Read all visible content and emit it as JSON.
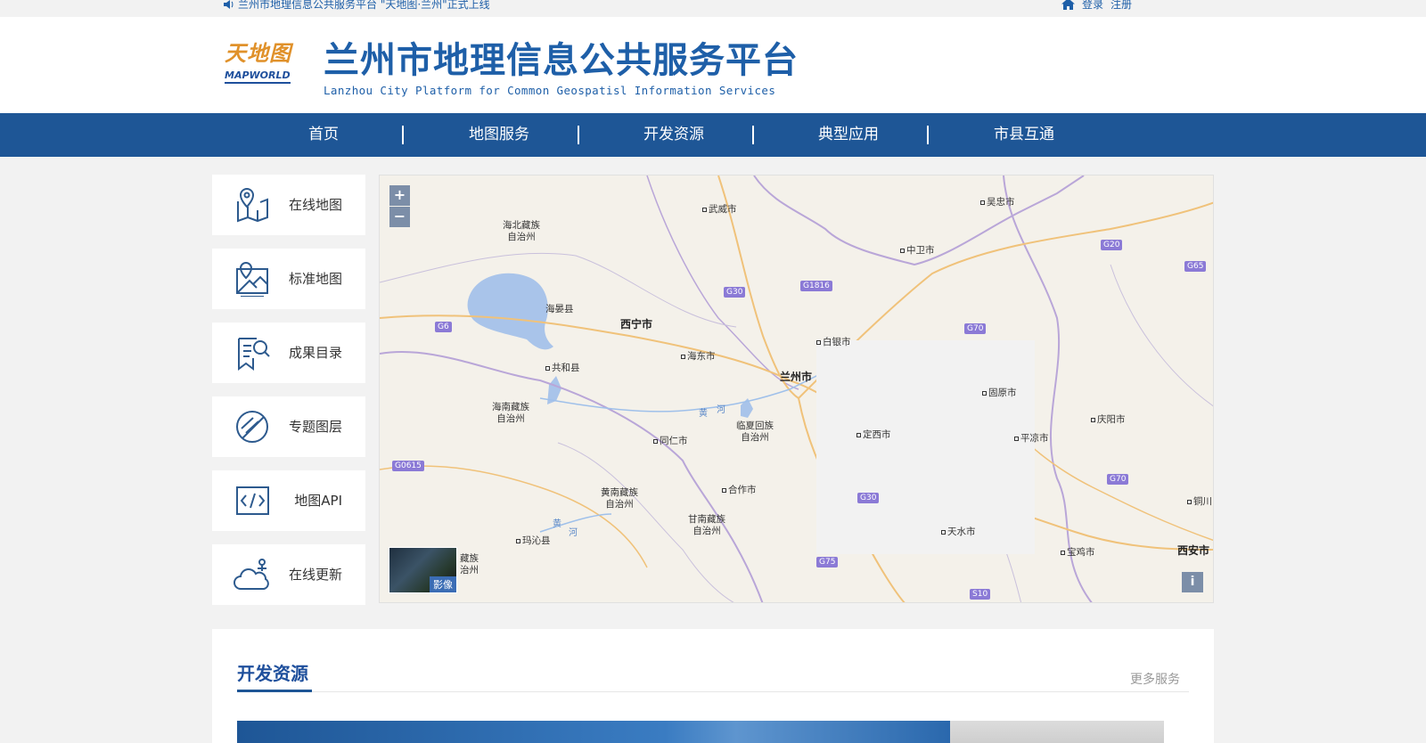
{
  "topbar": {
    "notice": "兰州市地理信息公共服务平台 \"天地图·兰州\"正式上线",
    "login": "登录",
    "register": "注册"
  },
  "header": {
    "logo_cn": "天地图",
    "logo_en": "MAPWORLD",
    "title": "兰州市地理信息公共服务平台",
    "subtitle": "Lanzhou City Platform for Common Geospatisl Information Services"
  },
  "nav": {
    "items": [
      {
        "label": "首页"
      },
      {
        "label": "地图服务"
      },
      {
        "label": "开发资源"
      },
      {
        "label": "典型应用"
      },
      {
        "label": "市县互通"
      }
    ]
  },
  "side_menu": {
    "items": [
      {
        "label": "在线地图",
        "icon": "map-pin-icon"
      },
      {
        "label": "标准地图",
        "icon": "map-frame-icon"
      },
      {
        "label": "成果目录",
        "icon": "catalog-search-icon"
      },
      {
        "label": "专题图层",
        "icon": "layer-circle-icon"
      },
      {
        "label": "地图API",
        "icon": "code-icon"
      },
      {
        "label": "在线更新",
        "icon": "cloud-update-icon"
      }
    ]
  },
  "map": {
    "zoom_in": "+",
    "zoom_out": "−",
    "image_toggle": "影像",
    "info": "i",
    "cities": {
      "wuwei": "武威市",
      "wuzhong": "吴忠市",
      "haibei": "海北藏族\n自治州",
      "zhongwei": "中卫市",
      "haiyan": "海晏县",
      "xining": "西宁市",
      "baiyin": "白银市",
      "haidong": "海东市",
      "lanzhou": "兰州市",
      "gonghe": "共和县",
      "guyuan": "固原市",
      "hainan": "海南藏族\n自治州",
      "linxia": "临夏回族\n自治州",
      "qingyang": "庆阳市",
      "dingxi": "定西市",
      "tongren": "同仁市",
      "pingliang": "平凉市",
      "huangnan": "黄南藏族\n自治州",
      "hezuo": "合作市",
      "gannan": "甘南藏族\n自治州",
      "maqin": "玛沁县",
      "tianshui": "天水市",
      "baoji": "宝鸡市",
      "xian": "西安市",
      "guoluo": "藏族\n治州",
      "tongchuan": "铜川"
    },
    "rivers": {
      "huanghe_a": "黄",
      "huanghe_b": "河",
      "huanghe_c": "黄",
      "huanghe_d": "河"
    },
    "roads": {
      "g30a": "G30",
      "g1816": "G1816",
      "g20": "G20",
      "g65": "G65",
      "g6": "G6",
      "g70a": "G70",
      "g0615": "G0615",
      "g70b": "G70",
      "g30b": "G30",
      "g75": "G75",
      "s10": "S10"
    }
  },
  "dev": {
    "title": "开发资源",
    "more": "更多服务"
  },
  "colors": {
    "brand_blue": "#1e5696",
    "text_blue": "#1e5fa8",
    "logo_orange": "#e0912a"
  }
}
